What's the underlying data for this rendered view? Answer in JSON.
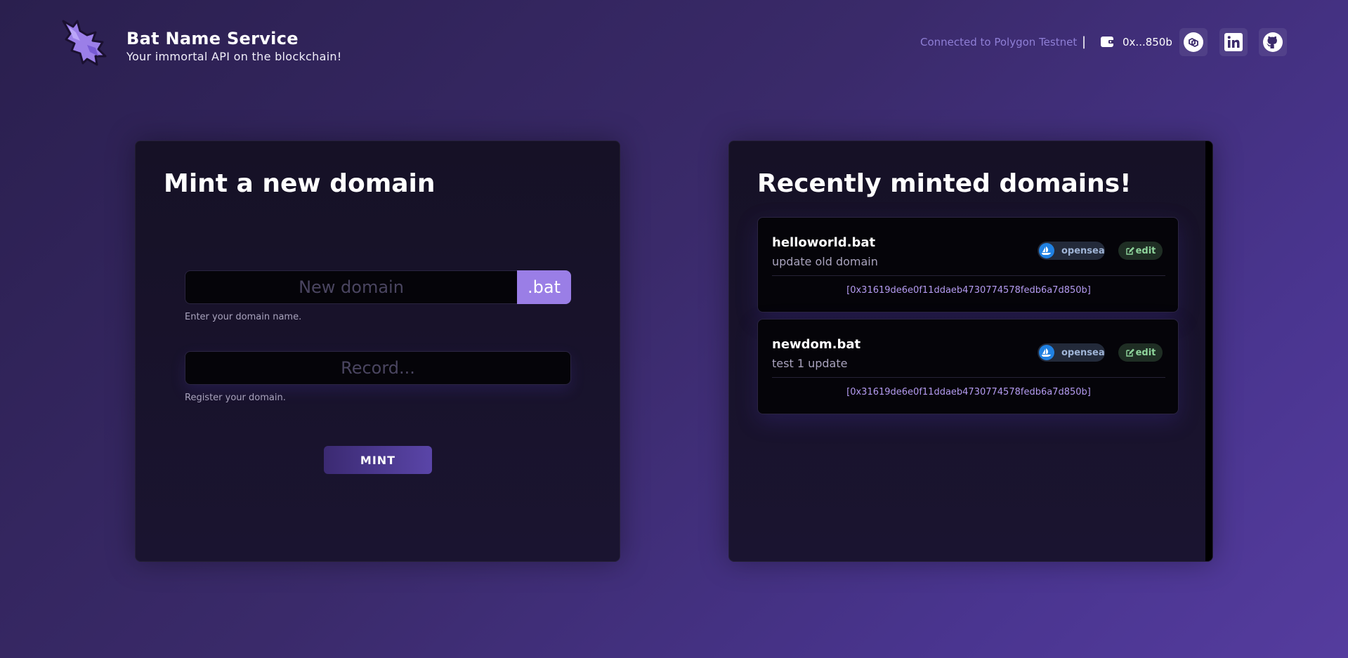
{
  "header": {
    "title": "Bat Name Service",
    "subtitle": "Your immortal API on the blockchain!",
    "network_status": "Connected to Polygon Testnet",
    "separator": "|",
    "wallet_address": "0x...850b"
  },
  "icons": {
    "logo": "bat-icon",
    "wallet": "wallet-icon",
    "social": [
      "polygon-icon",
      "linkedin-icon",
      "github-icon"
    ]
  },
  "mint_panel": {
    "title": "Mint a new domain",
    "domain_placeholder": "New domain",
    "tld": ".bat",
    "domain_hint": "Enter your domain name.",
    "record_placeholder": "Record...",
    "record_hint": "Register your domain.",
    "mint_label": "MINT"
  },
  "recent_panel": {
    "title": "Recently minted domains!",
    "opensea_label": "opensea",
    "edit_label": "edit",
    "domains": [
      {
        "name": "helloworld.bat",
        "record": "update old domain",
        "owner": "[0x31619de6e0f11ddaeb4730774578fedb6a7d850b]"
      },
      {
        "name": "newdom.bat",
        "record": "test 1 update",
        "owner": "[0x31619de6e0f11ddaeb4730774578fedb6a7d850b]"
      }
    ]
  },
  "colors": {
    "accent": "#9a7ee6",
    "opensea": "#2081e2",
    "edit": "#8fd59c"
  }
}
